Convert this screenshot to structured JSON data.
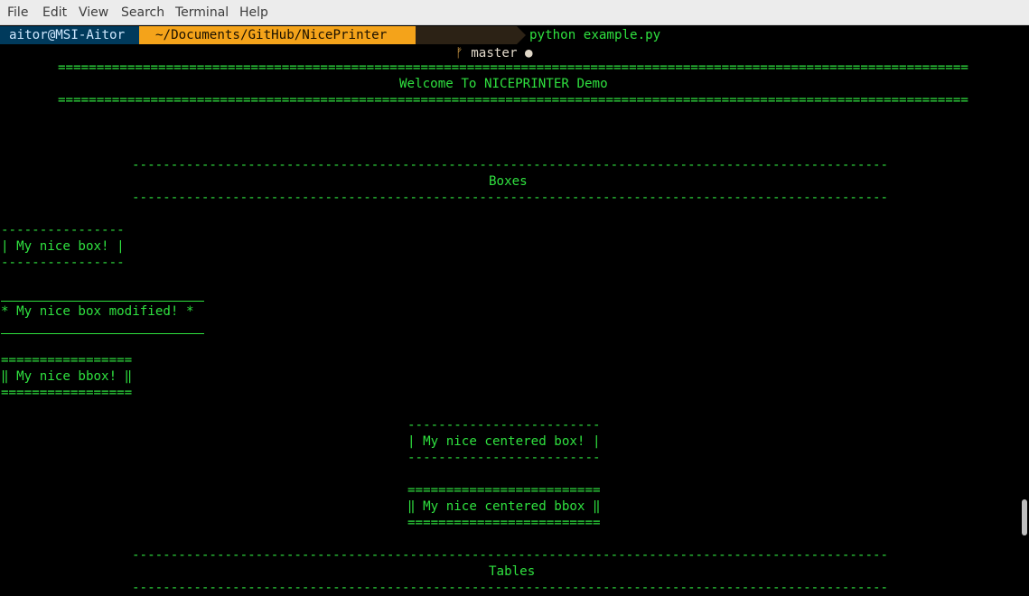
{
  "menu": {
    "items": [
      "File",
      "Edit",
      "View",
      "Search",
      "Terminal",
      "Help"
    ]
  },
  "prompt": {
    "user_host": "aitor@MSI-Aitor",
    "path": "~/Documents/GitHub/NicePrinter",
    "git_branch_icon": "git-branch-icon",
    "git_branch": "master",
    "git_status_dot": "●",
    "command": "python example.py",
    "colors": {
      "user_bg": "#003a5c",
      "path_bg": "#f4a31a",
      "git_bg": "#2c2215",
      "text_green": "#2fe03f"
    }
  },
  "output": {
    "welcome_rule_top": "================================================================================================================================",
    "welcome_title": "Welcome To NICEPRINTER Demo",
    "welcome_rule_bottom": "================================================================================================================================",
    "boxes_rule_top": "------------------------------------------------------------------------------------------------------------",
    "boxes_title": "Boxes",
    "boxes_rule_bottom": "------------------------------------------------------------------------------------------------------------",
    "box1_top": "----------------",
    "box1_text": "| My nice box! |",
    "box1_bottom": "----------------",
    "box2_text": "* My nice box modified! *",
    "bbox_top": "=================",
    "bbox_text": "‖ My nice bbox! ‖",
    "bbox_bottom": "=================",
    "cbox_top": "-------------------------",
    "cbox_text": "| My nice centered box! |",
    "cbox_bottom": "-------------------------",
    "cbbox_top": "=========================",
    "cbbox_text": "‖ My nice centered bbox ‖",
    "cbbox_bottom": "=========================",
    "tables_rule_top": "------------------------------------------------------------------------------------------------------------",
    "tables_title": "Tables",
    "tables_rule_bottom": "------------------------------------------------------------------------------------------------------------"
  }
}
